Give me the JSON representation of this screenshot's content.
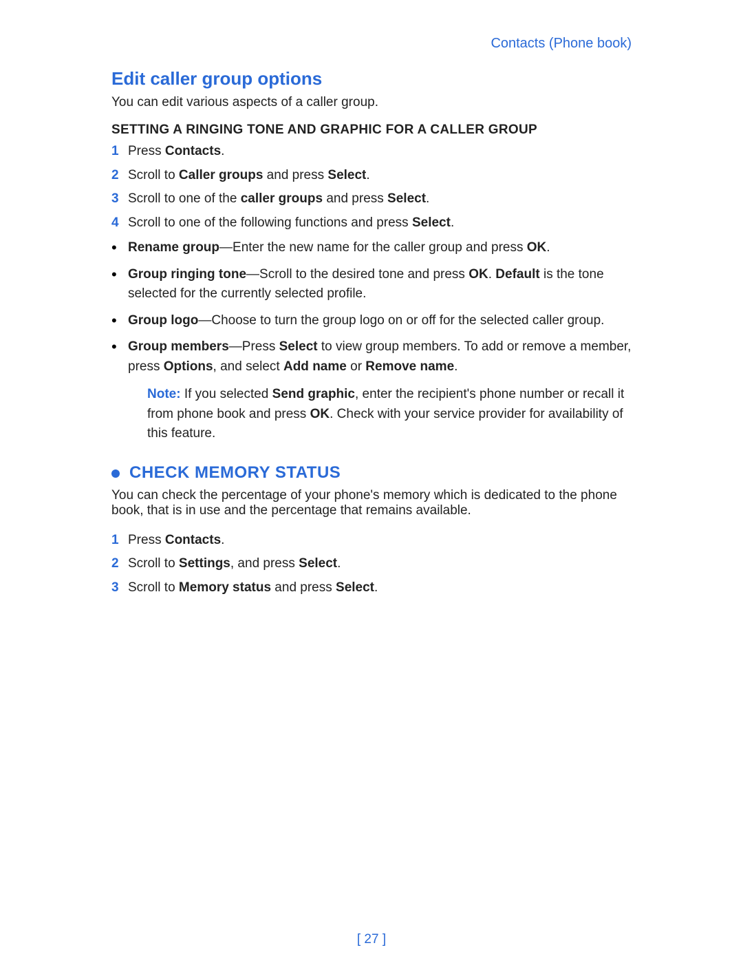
{
  "header": {
    "breadcrumb": "Contacts (Phone book)"
  },
  "section1": {
    "title": "Edit caller group options",
    "intro": "You can edit various aspects of a caller group.",
    "subhead": "SETTING A RINGING TONE AND GRAPHIC FOR A CALLER GROUP",
    "steps": [
      {
        "num": "1",
        "pre": "Press ",
        "b1": "Contacts",
        "post": "."
      },
      {
        "num": "2",
        "pre": "Scroll to ",
        "b1": "Caller groups",
        "mid": " and press ",
        "b2": "Select",
        "post": "."
      },
      {
        "num": "3",
        "pre": "Scroll to one of the ",
        "b1": "caller groups",
        "mid": " and press ",
        "b2": "Select",
        "post": "."
      },
      {
        "num": "4",
        "pre": "Scroll to one of the following functions and press ",
        "b1": "Select",
        "post": "."
      }
    ],
    "bullets": [
      {
        "b1": "Rename group",
        "t1": "—Enter the new name for the caller group and press ",
        "b2": "OK",
        "t2": "."
      },
      {
        "b1": "Group ringing tone",
        "t1": "—Scroll to the desired tone and press ",
        "b2": "OK",
        "t2": ". ",
        "b3": "Default",
        "t3": " is the tone selected for the currently selected profile."
      },
      {
        "b1": "Group logo",
        "t1": "—Choose to turn the group logo on or off for the selected caller group."
      },
      {
        "b1": "Group members",
        "t1": "—Press ",
        "b2": "Select",
        "t2": " to view group members. To add or remove a member, press ",
        "b3": "Options",
        "t3": ", and select ",
        "b4": "Add name",
        "t4": " or ",
        "b5": "Remove name",
        "t5": "."
      }
    ],
    "note": {
      "label": "Note:",
      "t1": " If you selected ",
      "b1": "Send graphic",
      "t2": ", enter the recipient's phone number or recall it from phone book and press ",
      "b2": "OK",
      "t3": ". Check with your service provider for availability of this feature."
    }
  },
  "section2": {
    "title": "CHECK MEMORY STATUS",
    "intro": "You can check the percentage of your phone's memory which is dedicated to the phone book, that is in use and the percentage that remains available.",
    "steps": [
      {
        "num": "1",
        "pre": "Press ",
        "b1": "Contacts",
        "post": "."
      },
      {
        "num": "2",
        "pre": "Scroll to ",
        "b1": "Settings",
        "mid": ", and press ",
        "b2": "Select",
        "post": "."
      },
      {
        "num": "3",
        "pre": "Scroll to ",
        "b1": "Memory status",
        "mid": " and press ",
        "b2": "Select",
        "post": "."
      }
    ]
  },
  "footer": {
    "page": "[ 27 ]"
  }
}
